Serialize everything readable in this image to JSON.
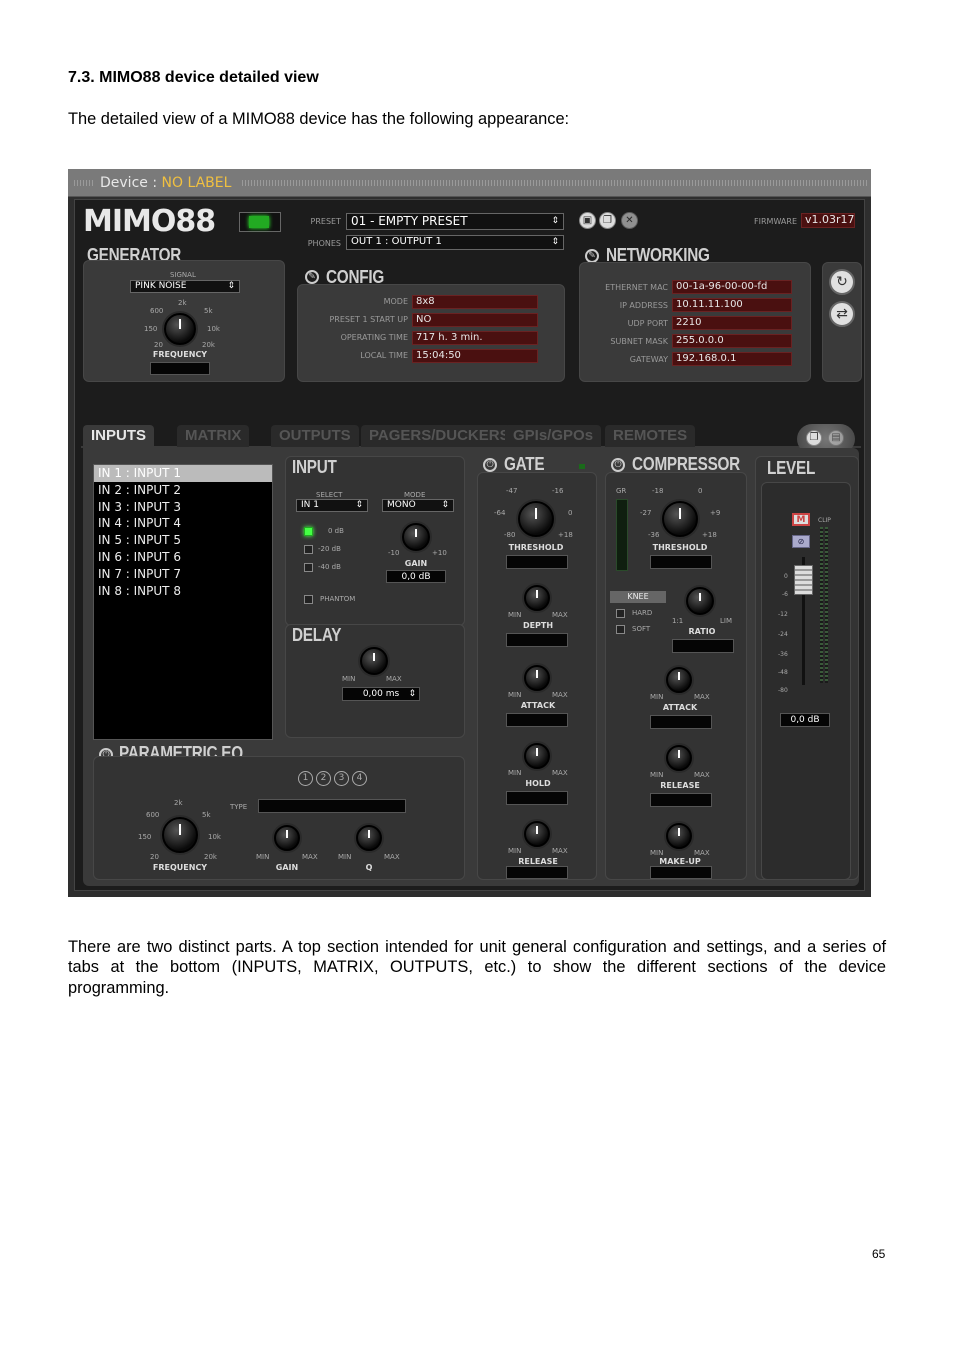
{
  "doc": {
    "heading": "7.3. MIMO88 device detailed view",
    "intro": "The detailed view of a MIMO88 device has the following appearance:",
    "outro": "There are two distinct parts. A top section intended for unit general configuration and settings, and a series of tabs at the bottom (INPUTS, MATRIX, OUTPUTS, etc.) to show the different sections of the device programming.",
    "page_number": "65"
  },
  "app": {
    "title_prefix": "Device :",
    "device_label": "NO LABEL",
    "logo": "MIMO88",
    "preset_label": "PRESET",
    "preset_value": "01 - EMPTY PRESET",
    "phones_label": "PHONES",
    "phones_value": "OUT 1 : OUTPUT 1",
    "firmware_label": "FIRMWARE",
    "firmware_value": "v1.03r17",
    "save-icon": "save-icon",
    "copy-icon": "copy-icon",
    "delete-icon": "trash-icon"
  },
  "generator": {
    "title": "GENERATOR",
    "signal_label": "SIGNAL",
    "signal_value": "PINK NOISE",
    "freq_label": "FREQUENCY",
    "ticks": [
      "2k",
      "600",
      "5k",
      "150",
      "10k",
      "20",
      "20k"
    ]
  },
  "config": {
    "title": "CONFIG",
    "rows": [
      {
        "label": "MODE",
        "value": "8x8"
      },
      {
        "label": "PRESET 1 START UP",
        "value": "NO"
      },
      {
        "label": "OPERATING TIME",
        "value": "717 h. 3 min."
      },
      {
        "label": "LOCAL TIME",
        "value": "15:04:50"
      }
    ]
  },
  "networking": {
    "title": "NETWORKING",
    "rows": [
      {
        "label": "ETHERNET MAC",
        "value": "00-1a-96-00-00-fd"
      },
      {
        "label": "IP ADDRESS",
        "value": "10.11.11.100"
      },
      {
        "label": "UDP PORT",
        "value": "2210"
      },
      {
        "label": "SUBNET MASK",
        "value": "255.0.0.0"
      },
      {
        "label": "GATEWAY",
        "value": "192.168.0.1"
      }
    ]
  },
  "tabs": [
    "INPUTS",
    "MATRIX",
    "OUTPUTS",
    "PAGERS/DUCKERS",
    "GPIs/GPOs",
    "REMOTES"
  ],
  "input_list": [
    "IN 1 : INPUT 1",
    "IN 2 : INPUT 2",
    "IN 3 : INPUT 3",
    "IN 4 : INPUT 4",
    "IN 5 : INPUT 5",
    "IN 6 : INPUT 6",
    "IN 7 : INPUT 7",
    "IN 8 : INPUT 8"
  ],
  "input": {
    "title": "INPUT",
    "select_label": "SELECT",
    "select_value": "IN 1",
    "mode_label": "MODE",
    "mode_value": "MONO",
    "gains": [
      "0 dB",
      "-20 dB",
      "-40 dB"
    ],
    "gain_label": "GAIN",
    "gain_value": "0,0 dB",
    "gain_min": "-10",
    "gain_max": "+10",
    "phantom": "PHANTOM"
  },
  "delay": {
    "title": "DELAY",
    "value": "0,00 ms",
    "min": "MIN",
    "max": "MAX"
  },
  "peq": {
    "title": "PARAMETRIC EQ",
    "bands": [
      "1",
      "2",
      "3",
      "4"
    ],
    "type_label": "TYPE",
    "freq_label": "FREQUENCY",
    "gain_label": "GAIN",
    "q_label": "Q",
    "min": "MIN",
    "max": "MAX",
    "ticks": [
      "2k",
      "600",
      "5k",
      "150",
      "10k",
      "20",
      "20k"
    ]
  },
  "gate": {
    "title": "GATE",
    "threshold": "THRESHOLD",
    "ticks": [
      "-47",
      "-16",
      "-64",
      "0",
      "-80",
      "+18"
    ],
    "depth": "DEPTH",
    "attack": "ATTACK",
    "hold": "HOLD",
    "release": "RELEASE",
    "min": "MIN",
    "max": "MAX"
  },
  "compressor": {
    "title": "COMPRESSOR",
    "gr": "GR",
    "threshold": "THRESHOLD",
    "ticks": [
      "-18",
      "0",
      "-27",
      "+9",
      "-36",
      "+18"
    ],
    "knee": "KNEE",
    "hard": "HARD",
    "soft": "SOFT",
    "ratio": "RATIO",
    "ratio_min": "1:1",
    "ratio_max": "LIM",
    "attack": "ATTACK",
    "release": "RELEASE",
    "makeup": "MAKE-UP",
    "min": "MIN",
    "max": "MAX"
  },
  "level": {
    "title": "LEVEL",
    "mute": "M",
    "clip": "CLIP",
    "scale": [
      "0",
      "-6",
      "-12",
      "-24",
      "-36",
      "-48",
      "-80"
    ],
    "value": "0,0 dB"
  }
}
